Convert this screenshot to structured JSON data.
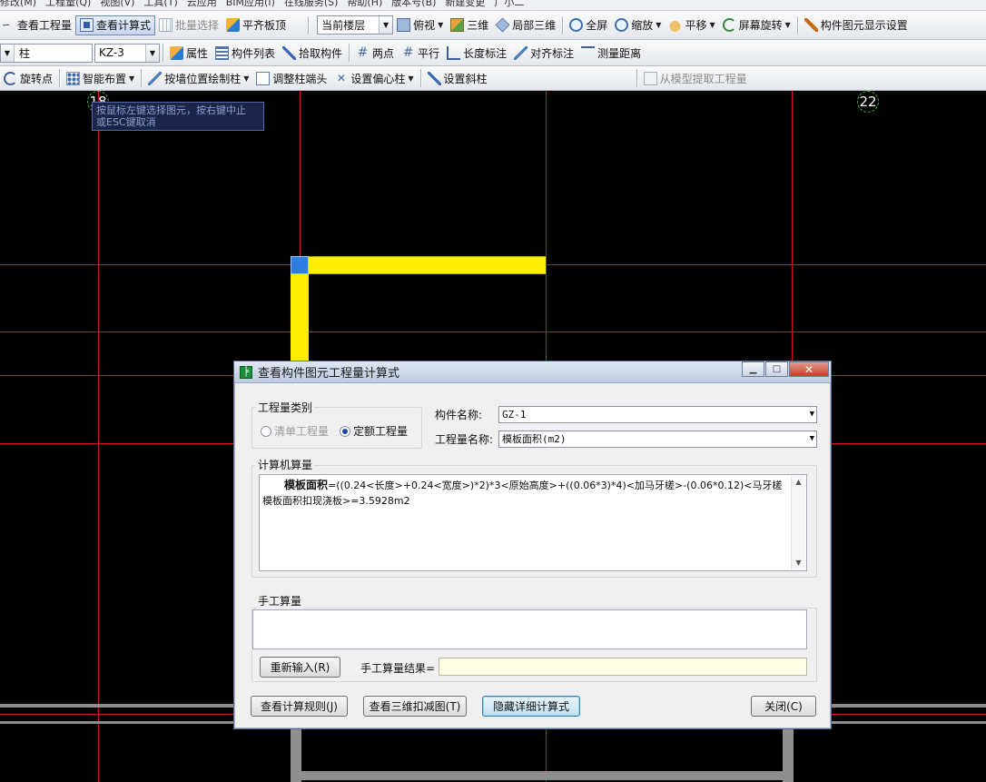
{
  "menubar": [
    "修改(M)",
    "工程量(Q)",
    "视图(V)",
    "工具(T)",
    "云应用",
    "BIM应用(I)",
    "在线服务(S)",
    "帮助(H)",
    "版本号(B)",
    "新建变更",
    "广小二"
  ],
  "toolbar1": {
    "view_quantity": "查看工程量",
    "view_formula": "查看计算式",
    "batch_select": "批量选择",
    "align_slab": "平齐板顶",
    "floor_select": "当前楼层",
    "top_view": "俯视",
    "three_d": "三维",
    "local_3d": "局部三维",
    "fullscreen": "全屏",
    "zoom": "缩放",
    "pan": "平移",
    "screen_rotate": "屏幕旋转",
    "display_settings": "构件图元显示设置"
  },
  "toolbar2": {
    "type_select": "柱",
    "component_select": "KZ-3",
    "properties": "属性",
    "component_list": "构件列表",
    "pick_component": "拾取构件",
    "two_points": "两点",
    "parallel": "平行",
    "length_dim": "长度标注",
    "align_dim": "对齐标注",
    "measure_distance": "测量距离"
  },
  "toolbar3": {
    "rotate_point": "旋转点",
    "smart_layout": "智能布置",
    "draw_by_wall": "按墙位置绘制柱",
    "adjust_column_end": "调整柱端头",
    "set_offset_column": "设置偏心柱",
    "set_inclined_column": "设置斜柱",
    "extract_from_model": "从模型提取工程量"
  },
  "canvas": {
    "axis_left": "18",
    "axis_right": "22",
    "tooltip_line1": "按鼠标左键选择图元，按右键中止",
    "tooltip_line2": "或ESC键取消"
  },
  "dialog": {
    "title": "查看构件图元工程量计算式",
    "quantity_category_label": "工程量类别",
    "radio_bill": "清单工程量",
    "radio_quota": "定额工程量",
    "component_name_label": "构件名称:",
    "component_name_value": "GZ-1",
    "quantity_name_label": "工程量名称:",
    "quantity_name_value": "模板面积(m2)",
    "computer_calc_label": "计算机算量",
    "formula_bold": "模板面积",
    "formula_rest": "=((0.24<长度>+0.24<宽度>)*2)*3<原始高度>+((0.06*3)*4)<加马牙槎>-(0.06*0.12)<马牙槎模板面积扣现浇板>=3.5928m2",
    "manual_calc_label": "手工算量",
    "reenter_button": "重新输入(R)",
    "manual_result_label": "手工算量结果=",
    "view_rules_button": "查看计算规则(J)",
    "view_3d_deduct_button": "查看三维扣减图(T)",
    "hide_detail_button": "隐藏详细计算式",
    "close_button": "关闭(C)"
  },
  "colors": {
    "grid_line": "#d9141e",
    "beam": "#ffee00",
    "column": "#2f7de0",
    "canvas_bg": "#000000"
  }
}
